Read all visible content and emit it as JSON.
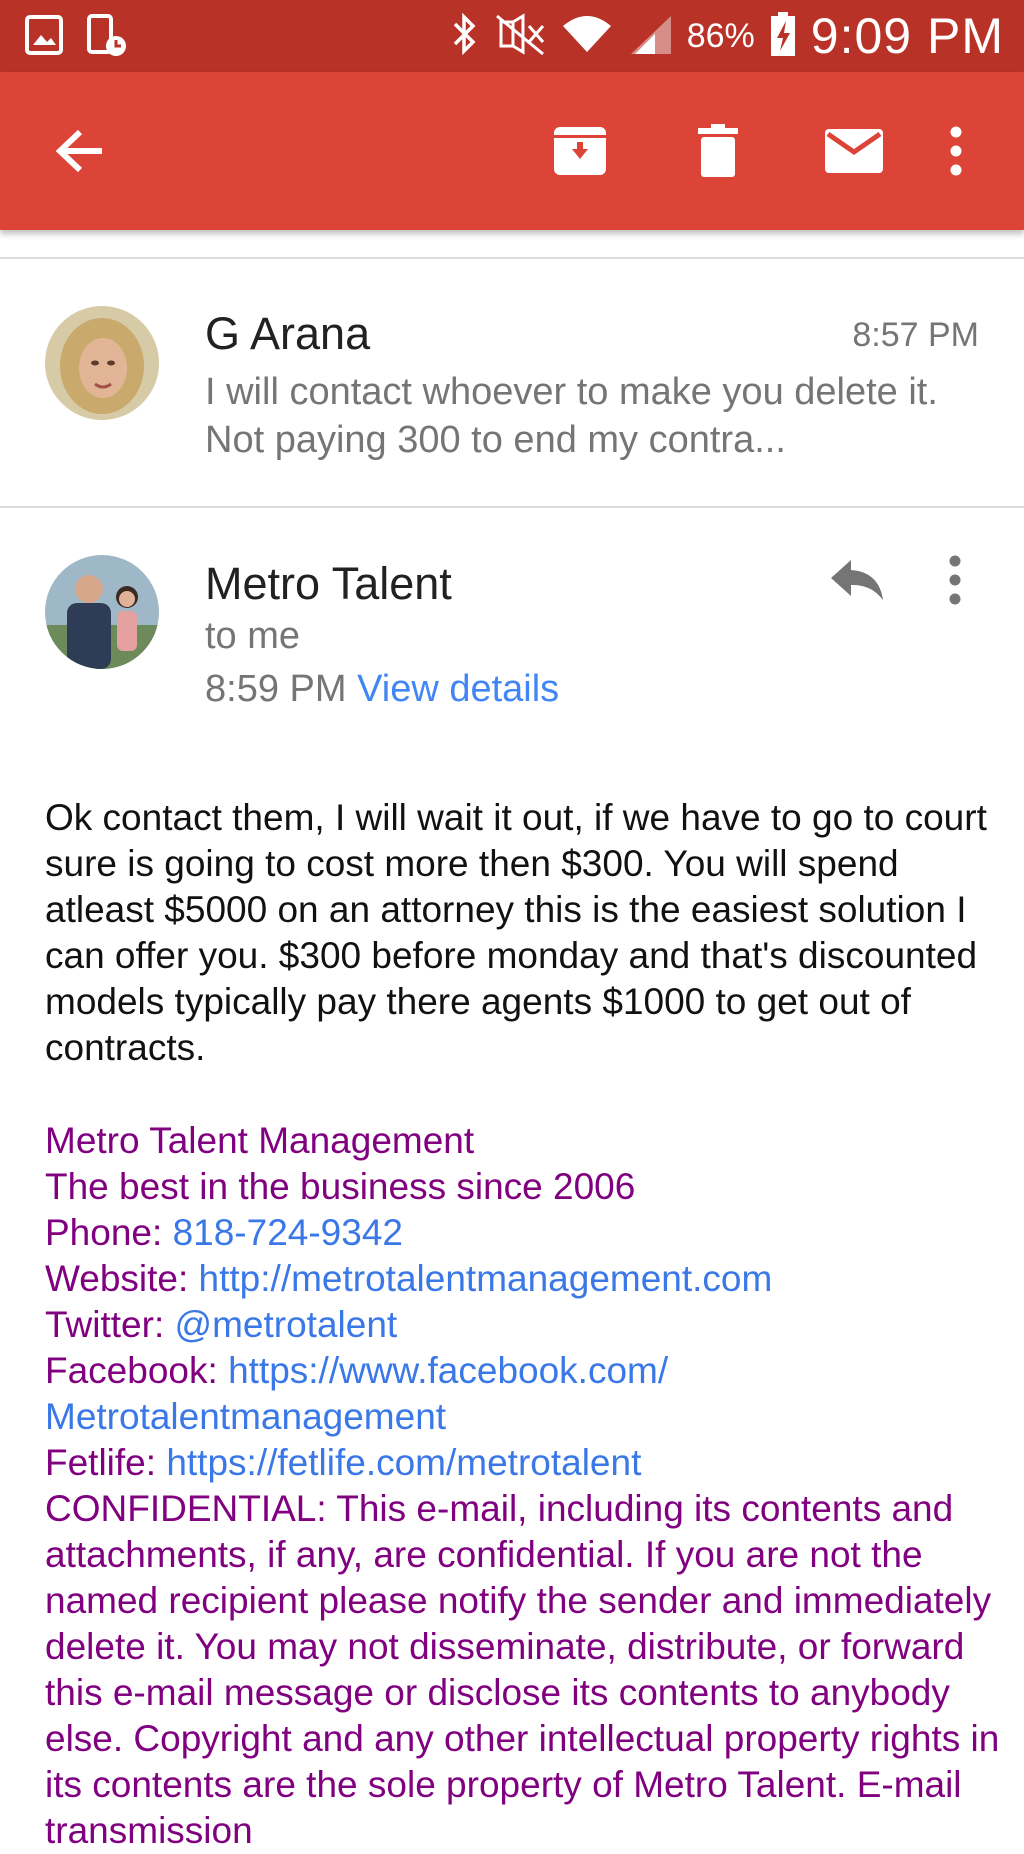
{
  "status_bar": {
    "battery_percent": "86%",
    "time": "9:09 PM",
    "icons": [
      "gallery-icon",
      "screen-time-icon",
      "bluetooth-icon",
      "nfc-muted-icon",
      "wifi-icon",
      "signal-icon",
      "battery-charging-icon"
    ]
  },
  "toolbar": {
    "icons": [
      "back-arrow-icon",
      "archive-icon",
      "trash-icon",
      "mark-unread-icon",
      "more-vert-icon"
    ],
    "bg_color": "#db4437"
  },
  "previous_message": {
    "sender": "G Arana",
    "time": "8:57 PM",
    "snippet": "I will contact whoever to make you delete it. Not paying 300 to end my contra..."
  },
  "current_message": {
    "sender": "Metro Talent",
    "recipient": "to me",
    "time": "8:59 PM",
    "view_details": "View details",
    "body": "Ok contact them, I will wait it out, if we have to go to court sure is going to cost more then $300. You will spend atleast $5000 on an attorney this is the easiest solution I can offer you. $300 before monday and that's discounted models typically pay there agents $1000 to get out of contracts."
  },
  "signature": {
    "company": "Metro Talent Management",
    "tagline": "The best in the business since 2006",
    "phone_label": "Phone: ",
    "phone": "818-724-9342",
    "website_label": "Website: ",
    "website": "http://metrotalentmanagement.com",
    "twitter_label": "Twitter: ",
    "twitter": "@metrotalent",
    "facebook_label": "Facebook: ",
    "facebook_line1": "https://www.facebook.com/",
    "facebook_line2": "Metrotalentmanagement",
    "fetlife_label": "Fetlife: ",
    "fetlife": "https://fetlife.com/metrotalent",
    "confidential": "CONFIDENTIAL: This e-mail, including its contents and attachments, if any, are confidential. If you are not the named recipient please notify the sender and immediately delete it. You may not disseminate, distribute, or forward this e-mail message or disclose its contents to anybody else. Copyright and any other intellectual property rights in its contents are the sole property of Metro Talent. E-mail transmission"
  },
  "colors": {
    "status_bar": "#b83227",
    "toolbar": "#db4437",
    "link": "#4285f4",
    "signature": "#800080"
  }
}
